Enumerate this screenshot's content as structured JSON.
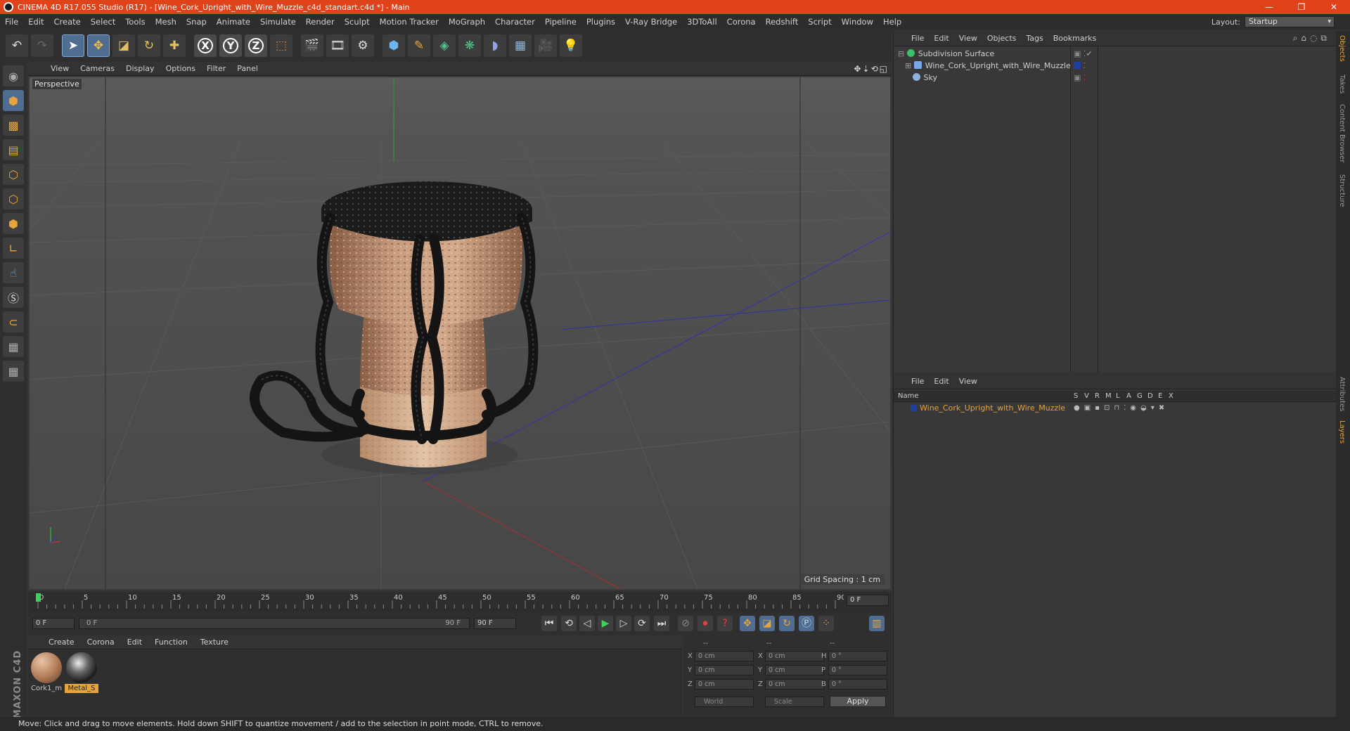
{
  "window": {
    "title": "CINEMA 4D R17.055 Studio (R17) - [Wine_Cork_Upright_with_Wire_Muzzle_c4d_standart.c4d *] - Main",
    "minimize": "—",
    "maximize": "❐",
    "close": "✕"
  },
  "menu": [
    "File",
    "Edit",
    "Create",
    "Select",
    "Tools",
    "Mesh",
    "Snap",
    "Animate",
    "Simulate",
    "Render",
    "Sculpt",
    "Motion Tracker",
    "MoGraph",
    "Character",
    "Pipeline",
    "Plugins",
    "V-Ray Bridge",
    "3DToAll",
    "Corona",
    "Redshift",
    "Script",
    "Window",
    "Help"
  ],
  "layout": {
    "label": "Layout:",
    "value": "Startup"
  },
  "viewport": {
    "menu": [
      "View",
      "Cameras",
      "Display",
      "Options",
      "Filter",
      "Panel"
    ],
    "camera_label": "Perspective",
    "grid_spacing": "Grid Spacing : 1 cm",
    "nav_icons": "✥⇣⟲◱"
  },
  "timeline": {
    "ticks": [
      "0",
      "5",
      "10",
      "15",
      "20",
      "25",
      "30",
      "35",
      "40",
      "45",
      "50",
      "55",
      "60",
      "65",
      "70",
      "75",
      "80",
      "85",
      "90"
    ],
    "current_frame": "0 F"
  },
  "controls": {
    "start_frame": "0 F",
    "range_start": "0 F",
    "range_end": "90 F",
    "end_frame": "90 F"
  },
  "material_manager": {
    "menu": [
      "Create",
      "Corona",
      "Edit",
      "Function",
      "Texture"
    ],
    "materials": [
      {
        "name": "Cork1_m",
        "color": "#b07a55"
      },
      {
        "name": "Metal_S",
        "color": "#2a2a2a"
      }
    ]
  },
  "coords": {
    "headers": [
      "--",
      "--",
      "--"
    ],
    "rows": [
      {
        "a": "X",
        "v1": "0 cm",
        "b": "X",
        "v2": "0 cm",
        "c": "H",
        "v3": "0 °"
      },
      {
        "a": "Y",
        "v1": "0 cm",
        "b": "Y",
        "v2": "0 cm",
        "c": "P",
        "v3": "0 °"
      },
      {
        "a": "Z",
        "v1": "0 cm",
        "b": "Z",
        "v2": "0 cm",
        "c": "B",
        "v3": "0 °"
      }
    ],
    "mode": "World",
    "scale": "Scale",
    "apply": "Apply"
  },
  "status": "Move: Click and drag to move elements. Hold down SHIFT to quantize movement / add to the selection in point mode, CTRL to remove.",
  "object_manager": {
    "menu": [
      "File",
      "Edit",
      "View",
      "Objects",
      "Tags",
      "Bookmarks"
    ],
    "objects": [
      {
        "name": "Subdivision Surface",
        "color": "#3bc06a"
      },
      {
        "name": "Wine_Cork_Upright_with_Wire_Muzzle",
        "color": "#7aa8e6"
      },
      {
        "name": "Sky",
        "color": "#8fb3d8"
      }
    ]
  },
  "layer_manager": {
    "menu": [
      "File",
      "Edit",
      "View"
    ],
    "columns": [
      "Name",
      "S",
      "V",
      "R",
      "M",
      "L",
      "A",
      "G",
      "D",
      "E",
      "X"
    ],
    "layer_name": "Wine_Cork_Upright_with_Wire_Muzzle",
    "layer_color": "#1f3fa0"
  },
  "right_tabs": [
    "Objects",
    "Takes",
    "Content Browser",
    "Structure",
    "Attributes",
    "Layers"
  ]
}
